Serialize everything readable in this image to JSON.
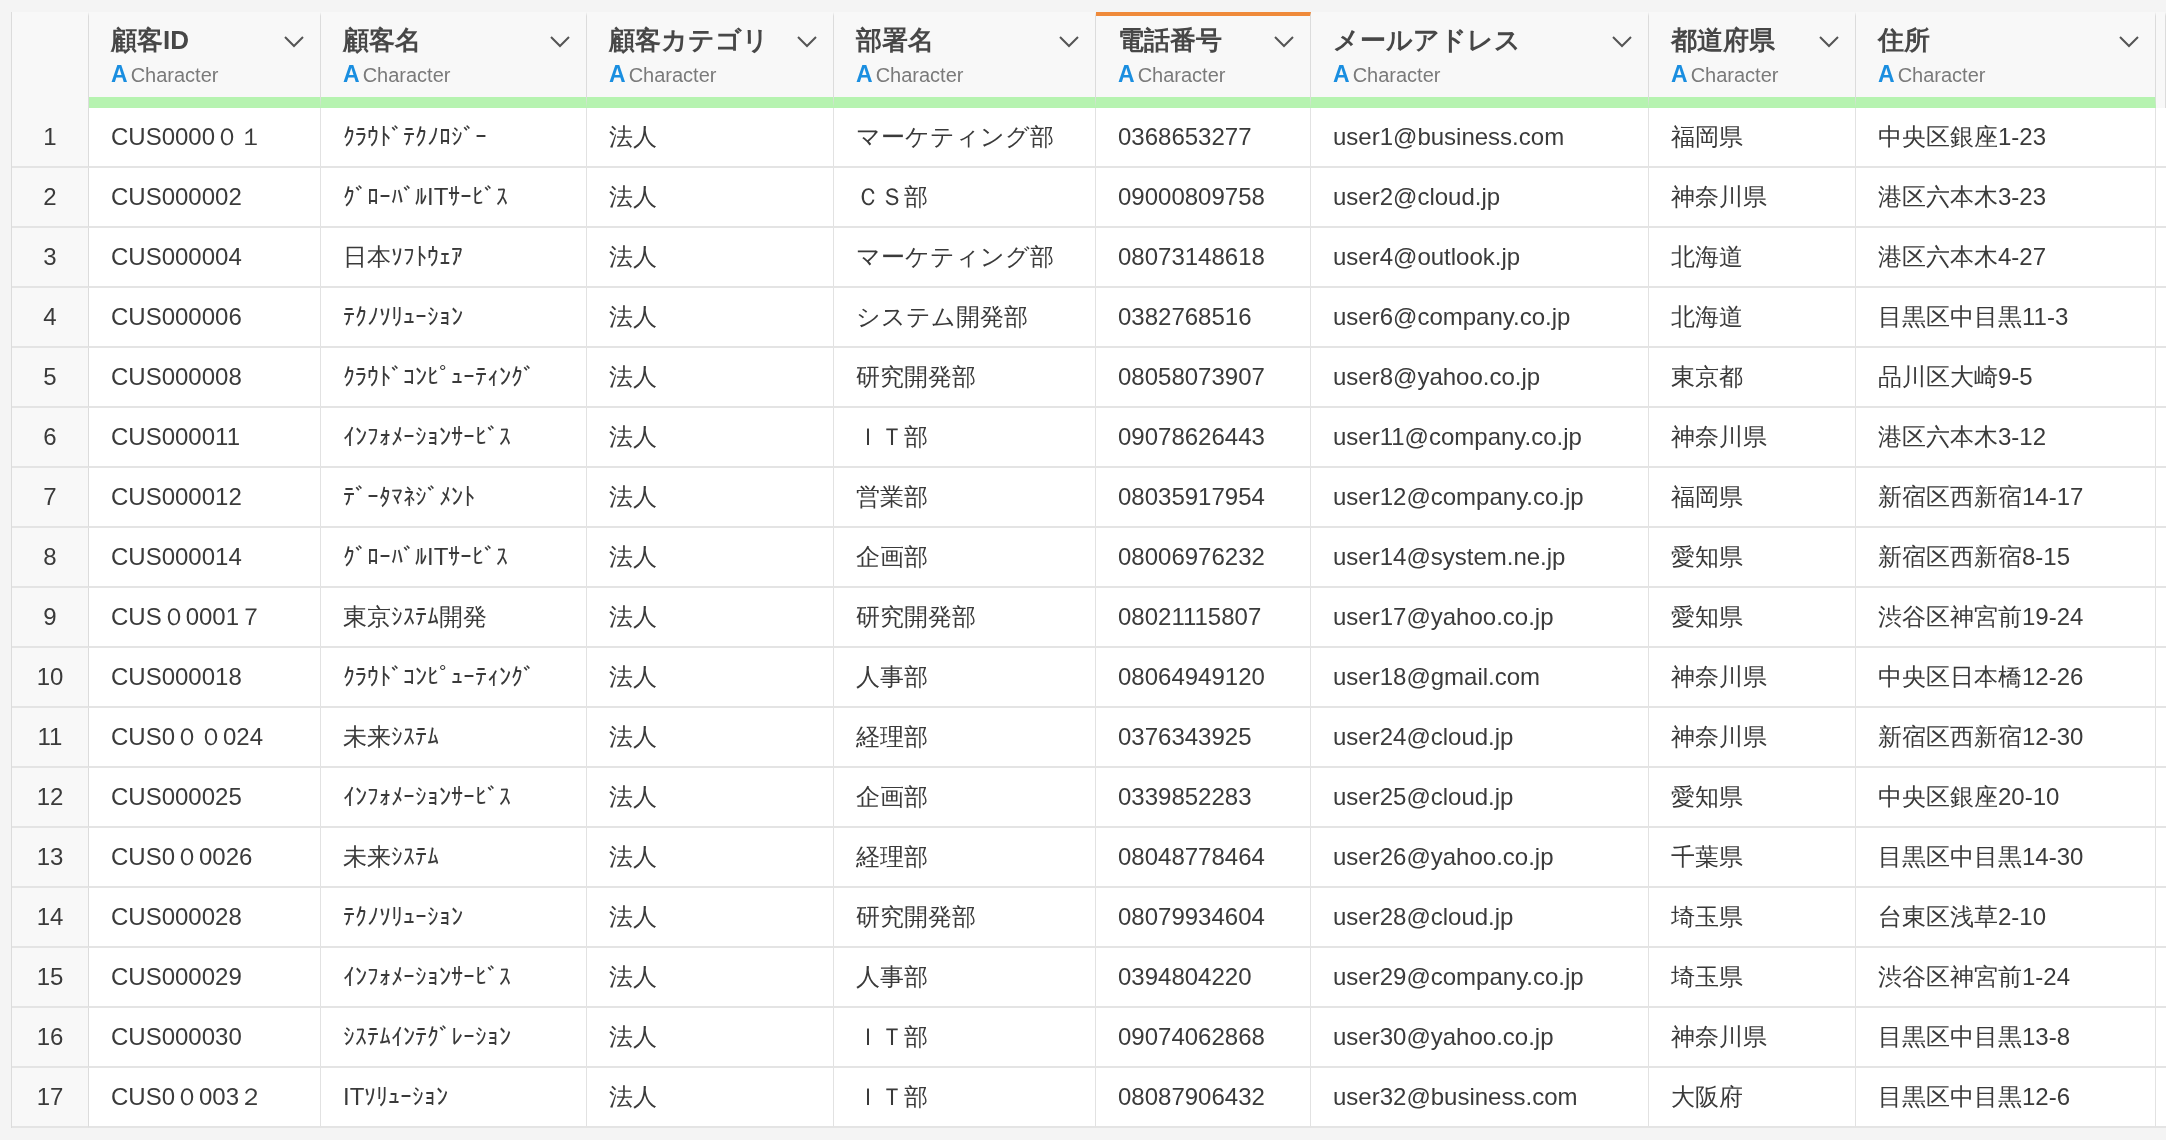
{
  "columns": [
    {
      "title": "顧客ID",
      "type_icon": "A",
      "type": "Character",
      "selected": false
    },
    {
      "title": "顧客名",
      "type_icon": "A",
      "type": "Character",
      "selected": false
    },
    {
      "title": "顧客カテゴリ",
      "type_icon": "A",
      "type": "Character",
      "selected": false
    },
    {
      "title": "部署名",
      "type_icon": "A",
      "type": "Character",
      "selected": false
    },
    {
      "title": "電話番号",
      "type_icon": "A",
      "type": "Character",
      "selected": true
    },
    {
      "title": "メールアドレス",
      "type_icon": "A",
      "type": "Character",
      "selected": false
    },
    {
      "title": "都道府県",
      "type_icon": "A",
      "type": "Character",
      "selected": false
    },
    {
      "title": "住所",
      "type_icon": "A",
      "type": "Character",
      "selected": false
    }
  ],
  "rows": [
    {
      "number": "1",
      "cells": [
        "CUS0000０１",
        "ｸﾗｳﾄﾞﾃｸﾉﾛｼﾞｰ",
        "法人",
        "マーケティング部",
        "0368653277",
        "user1@business.com",
        "福岡県",
        "中央区銀座1-23"
      ]
    },
    {
      "number": "2",
      "cells": [
        "CUS000002",
        "ｸﾞﾛｰﾊﾞﾙITｻｰﾋﾞｽ",
        "法人",
        "ＣＳ部",
        "09000809758",
        "user2@cloud.jp",
        "神奈川県",
        "港区六本木3-23"
      ]
    },
    {
      "number": "3",
      "cells": [
        "CUS000004",
        "日本ｿﾌﾄｳｪｱ",
        "法人",
        "マーケティング部",
        "08073148618",
        "user4@outlook.jp",
        "北海道",
        "港区六本木4-27"
      ]
    },
    {
      "number": "4",
      "cells": [
        "CUS000006",
        "ﾃｸﾉｿﾘｭｰｼｮﾝ",
        "法人",
        "システム開発部",
        "0382768516",
        "user6@company.co.jp",
        "北海道",
        "目黒区中目黒11-3"
      ]
    },
    {
      "number": "5",
      "cells": [
        "CUS000008",
        "ｸﾗｳﾄﾞｺﾝﾋﾟｭｰﾃｨﾝｸﾞ",
        "法人",
        "研究開発部",
        "08058073907",
        "user8@yahoo.co.jp",
        "東京都",
        "品川区大崎9-5"
      ]
    },
    {
      "number": "6",
      "cells": [
        "CUS000011",
        "ｲﾝﾌｫﾒｰｼｮﾝｻｰﾋﾞｽ",
        "法人",
        "ＩＴ部",
        "09078626443",
        "user11@company.co.jp",
        "神奈川県",
        "港区六本木3-12"
      ]
    },
    {
      "number": "7",
      "cells": [
        "CUS000012",
        "ﾃﾞｰﾀﾏﾈｼﾞﾒﾝﾄ",
        "法人",
        "営業部",
        "08035917954",
        "user12@company.co.jp",
        "福岡県",
        "新宿区西新宿14-17"
      ]
    },
    {
      "number": "8",
      "cells": [
        "CUS000014",
        "ｸﾞﾛｰﾊﾞﾙITｻｰﾋﾞｽ",
        "法人",
        "企画部",
        "08006976232",
        "user14@system.ne.jp",
        "愛知県",
        "新宿区西新宿8-15"
      ]
    },
    {
      "number": "9",
      "cells": [
        "CUS０0001７",
        "東京ｼｽﾃﾑ開発",
        "法人",
        "研究開発部",
        "08021115807",
        "user17@yahoo.co.jp",
        "愛知県",
        "渋谷区神宮前19-24"
      ]
    },
    {
      "number": "10",
      "cells": [
        "CUS000018",
        "ｸﾗｳﾄﾞｺﾝﾋﾟｭｰﾃｨﾝｸﾞ",
        "法人",
        "人事部",
        "08064949120",
        "user18@gmail.com",
        "神奈川県",
        "中央区日本橋12-26"
      ]
    },
    {
      "number": "11",
      "cells": [
        "CUS0００024",
        "未来ｼｽﾃﾑ",
        "法人",
        "経理部",
        "0376343925",
        "user24@cloud.jp",
        "神奈川県",
        "新宿区西新宿12-30"
      ]
    },
    {
      "number": "12",
      "cells": [
        "CUS000025",
        "ｲﾝﾌｫﾒｰｼｮﾝｻｰﾋﾞｽ",
        "法人",
        "企画部",
        "0339852283",
        "user25@cloud.jp",
        "愛知県",
        "中央区銀座20-10"
      ]
    },
    {
      "number": "13",
      "cells": [
        "CUS0０0026",
        "未来ｼｽﾃﾑ",
        "法人",
        "経理部",
        "08048778464",
        "user26@yahoo.co.jp",
        "千葉県",
        "目黒区中目黒14-30"
      ]
    },
    {
      "number": "14",
      "cells": [
        "CUS000028",
        "ﾃｸﾉｿﾘｭｰｼｮﾝ",
        "法人",
        "研究開発部",
        "08079934604",
        "user28@cloud.jp",
        "埼玉県",
        "台東区浅草2-10"
      ]
    },
    {
      "number": "15",
      "cells": [
        "CUS000029",
        "ｲﾝﾌｫﾒｰｼｮﾝｻｰﾋﾞｽ",
        "法人",
        "人事部",
        "0394804220",
        "user29@company.co.jp",
        "埼玉県",
        "渋谷区神宮前1-24"
      ]
    },
    {
      "number": "16",
      "cells": [
        "CUS000030",
        "ｼｽﾃﾑｲﾝﾃｸﾞﾚｰｼｮﾝ",
        "法人",
        "ＩＴ部",
        "09074062868",
        "user30@yahoo.co.jp",
        "神奈川県",
        "目黒区中目黒13-8"
      ]
    },
    {
      "number": "17",
      "cells": [
        "CUS0０003２",
        "ITｿﾘｭｰｼｮﾝ",
        "法人",
        "ＩＴ部",
        "08087906432",
        "user32@business.com",
        "大阪府",
        "目黒区中目黒12-6"
      ]
    }
  ]
}
